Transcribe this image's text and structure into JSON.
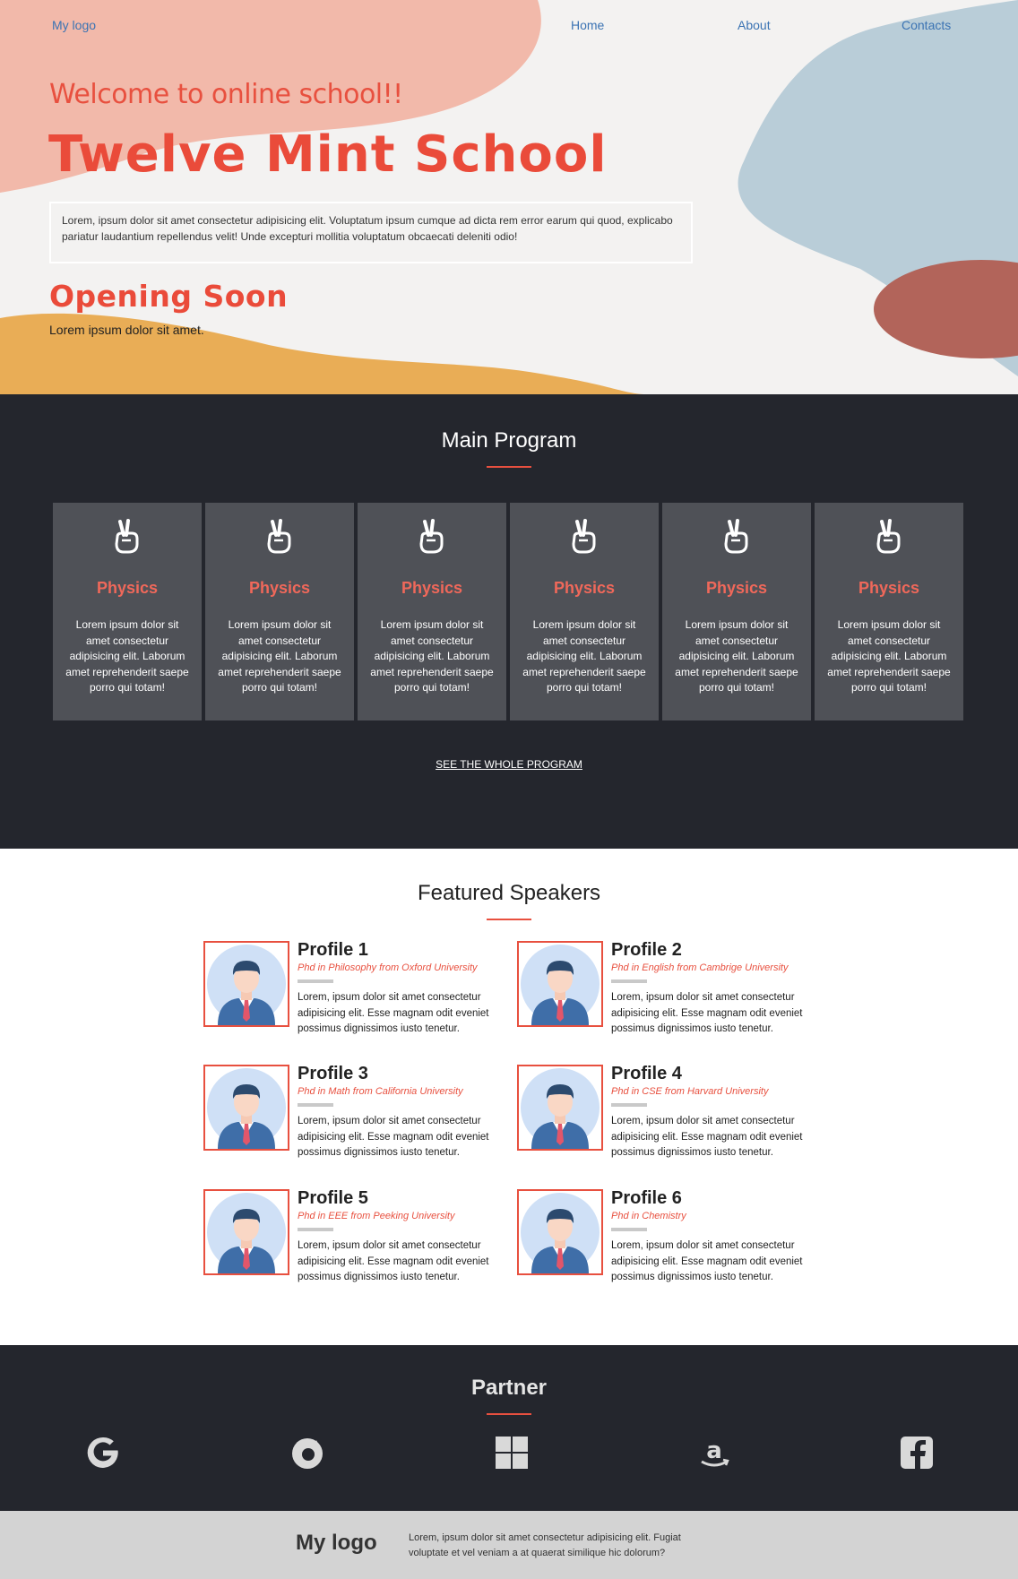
{
  "nav": {
    "logo": "My logo",
    "links": [
      "Home",
      "About",
      "Contacts"
    ]
  },
  "hero": {
    "welcome": "Welcome to online school!!",
    "title": "Twelve Mint School",
    "description": "Lorem, ipsum dolor sit amet consectetur adipisicing elit. Voluptatum ipsum cumque ad dicta rem error earum qui quod, explicabo pariatur laudantium repellendus velit! Unde excepturi mollitia voluptatum obcaecati deleniti odio!",
    "opening_title": "Opening Soon",
    "opening_text": "Lorem ipsum dolor sit amet."
  },
  "program": {
    "title": "Main Program",
    "icon": "victory-hand-icon",
    "cards": [
      {
        "title": "Physics",
        "text": "Lorem ipsum dolor sit amet consectetur adipisicing elit. Laborum amet reprehenderit saepe porro qui totam!"
      },
      {
        "title": "Physics",
        "text": "Lorem ipsum dolor sit amet consectetur adipisicing elit. Laborum amet reprehenderit saepe porro qui totam!"
      },
      {
        "title": "Physics",
        "text": "Lorem ipsum dolor sit amet consectetur adipisicing elit. Laborum amet reprehenderit saepe porro qui totam!"
      },
      {
        "title": "Physics",
        "text": "Lorem ipsum dolor sit amet consectetur adipisicing elit. Laborum amet reprehenderit saepe porro qui totam!"
      },
      {
        "title": "Physics",
        "text": "Lorem ipsum dolor sit amet consectetur adipisicing elit. Laborum amet reprehenderit saepe porro qui totam!"
      },
      {
        "title": "Physics",
        "text": "Lorem ipsum dolor sit amet consectetur adipisicing elit. Laborum amet reprehenderit saepe porro qui totam!"
      }
    ],
    "link": "SEE THE WHOLE PROGRAM"
  },
  "speakers": {
    "title": "Featured Speakers",
    "profiles": [
      {
        "name": "Profile 1",
        "degree": "Phd in Philosophy from Oxford University",
        "text": "Lorem, ipsum dolor sit amet consectetur adipisicing elit. Esse magnam odit eveniet possimus dignissimos iusto tenetur."
      },
      {
        "name": "Profile 2",
        "degree": "Phd in English from Cambrige University",
        "text": "Lorem, ipsum dolor sit amet consectetur adipisicing elit. Esse magnam odit eveniet possimus dignissimos iusto tenetur."
      },
      {
        "name": "Profile 3",
        "degree": "Phd in Math from California University",
        "text": "Lorem, ipsum dolor sit amet consectetur adipisicing elit. Esse magnam odit eveniet possimus dignissimos iusto tenetur."
      },
      {
        "name": "Profile 4",
        "degree": "Phd in CSE from Harvard University",
        "text": "Lorem, ipsum dolor sit amet consectetur adipisicing elit. Esse magnam odit eveniet possimus dignissimos iusto tenetur."
      },
      {
        "name": "Profile 5",
        "degree": "Phd in EEE from Peeking University",
        "text": "Lorem, ipsum dolor sit amet consectetur adipisicing elit. Esse magnam odit eveniet possimus dignissimos iusto tenetur."
      },
      {
        "name": "Profile 6",
        "degree": "Phd in Chemistry",
        "text": "Lorem, ipsum dolor sit amet consectetur adipisicing elit. Esse magnam odit eveniet possimus dignissimos iusto tenetur."
      }
    ]
  },
  "partner": {
    "title": "Partner",
    "logos": [
      "google-icon",
      "firefox-icon",
      "windows-icon",
      "amazon-icon",
      "facebook-icon"
    ]
  },
  "footer": {
    "logo": "My logo",
    "text": "Lorem, ipsum dolor sit amet consectetur adipisicing elit. Fugiat voluptate et vel veniam a at quaerat similique hic dolorum?"
  },
  "colors": {
    "accent": "#e8503f",
    "dark": "#24262d",
    "card": "#4f5157",
    "link": "#3b73b3"
  }
}
